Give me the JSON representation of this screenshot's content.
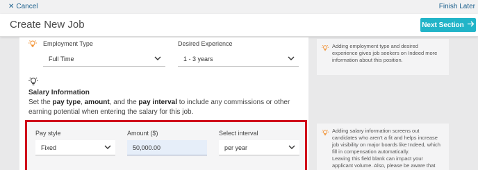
{
  "topbar": {
    "cancel_label": "Cancel",
    "finish_label": "Finish Later"
  },
  "header": {
    "title": "Create New Job",
    "next_label": "Next Section"
  },
  "employment": {
    "type_label": "Employment Type",
    "type_value": "Full Time",
    "experience_label": "Desired Experience",
    "experience_value": "1 - 3 years"
  },
  "tips": {
    "employment": "Adding employment type and desired experience gives job seekers on Indeed more information about this position.",
    "salary": "Adding salary information screens out candidates who aren't a fit and helps increase job visibility on major boards like Indeed, which fill in compensation automatically.",
    "salary_2": "Leaving this field blank can impact your applicant volume. Also, please be aware that some cities and"
  },
  "salary": {
    "title": "Salary Information",
    "desc_1": "Set the ",
    "desc_pay_type": "pay type",
    "desc_2": ", ",
    "desc_amount": "amount",
    "desc_3": ", and the ",
    "desc_interval": "pay interval",
    "desc_4": " to include any commissions or other earning potential when entering the salary for this job.",
    "pay_style_label": "Pay style",
    "pay_style_value": "Fixed",
    "amount_label": "Amount ($)",
    "amount_value": "50,000.00",
    "interval_label": "Select interval",
    "interval_value": "per year"
  },
  "colors": {
    "accent": "#21b4c8",
    "link": "#1b5f8c",
    "highlight": "#d0021b",
    "bulb": "#f28c28"
  }
}
